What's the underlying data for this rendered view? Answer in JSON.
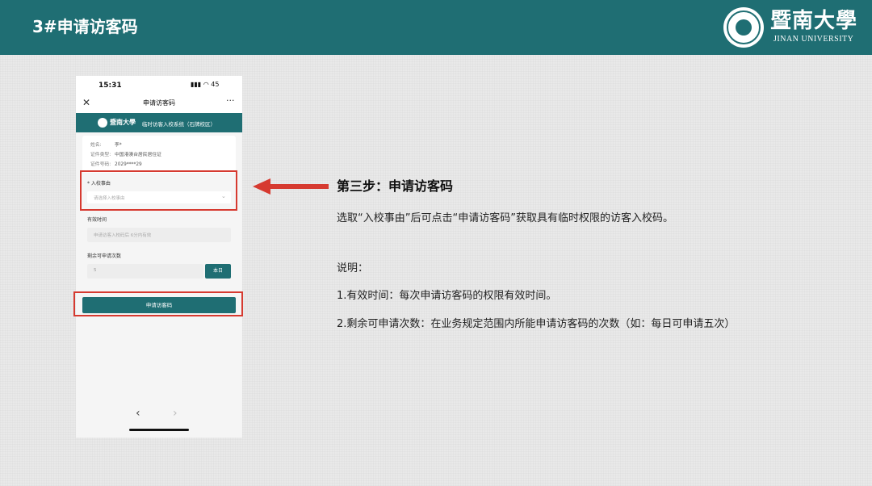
{
  "slide": {
    "title": "3#申请访客码",
    "logo_cn": "暨南大學",
    "logo_en": "JINAN UNIVERSITY"
  },
  "phone": {
    "status_time": "15:31",
    "status_icons": "▮▮▮ ◠ 45",
    "nav_close": "✕",
    "nav_title": "申请访客码",
    "nav_more": "···",
    "system_brand": "暨南大學",
    "system_name": "临时访客入校系统（石牌校区）",
    "info": [
      {
        "label": "姓名:",
        "value": "李*"
      },
      {
        "label": "证件类型:",
        "value": "中国港澳台居民居住证"
      },
      {
        "label": "证件号码:",
        "value": "2029****29"
      }
    ],
    "reason_label": "* 入校事由",
    "reason_placeholder": "请选择入校事由",
    "reason_chevron": "⌄",
    "valid_label": "有效时间",
    "valid_placeholder": "申请访客入校码后 6分内有效",
    "remain_label": "剩余可申请次数",
    "remain_value": "5",
    "today_button": "本日",
    "apply_button": "申请访客码",
    "back_arrow": "‹",
    "forward_arrow": "›"
  },
  "instructions": {
    "step_title": "第三步：申请访客码",
    "step_desc": "选取“入校事由”后可点击“申请访客码”获取具有临时权限的访客入校码。",
    "note_title": "说明：",
    "note_1": "1.有效时间：每次申请访客码的权限有效时间。",
    "note_2": "2.剩余可申请次数：在业务规定范围内所能申请访客码的次数（如：每日可申请五次）"
  },
  "colors": {
    "brand_teal": "#1f6e73",
    "highlight_red": "#d63a30",
    "background": "#e9e9e9"
  }
}
